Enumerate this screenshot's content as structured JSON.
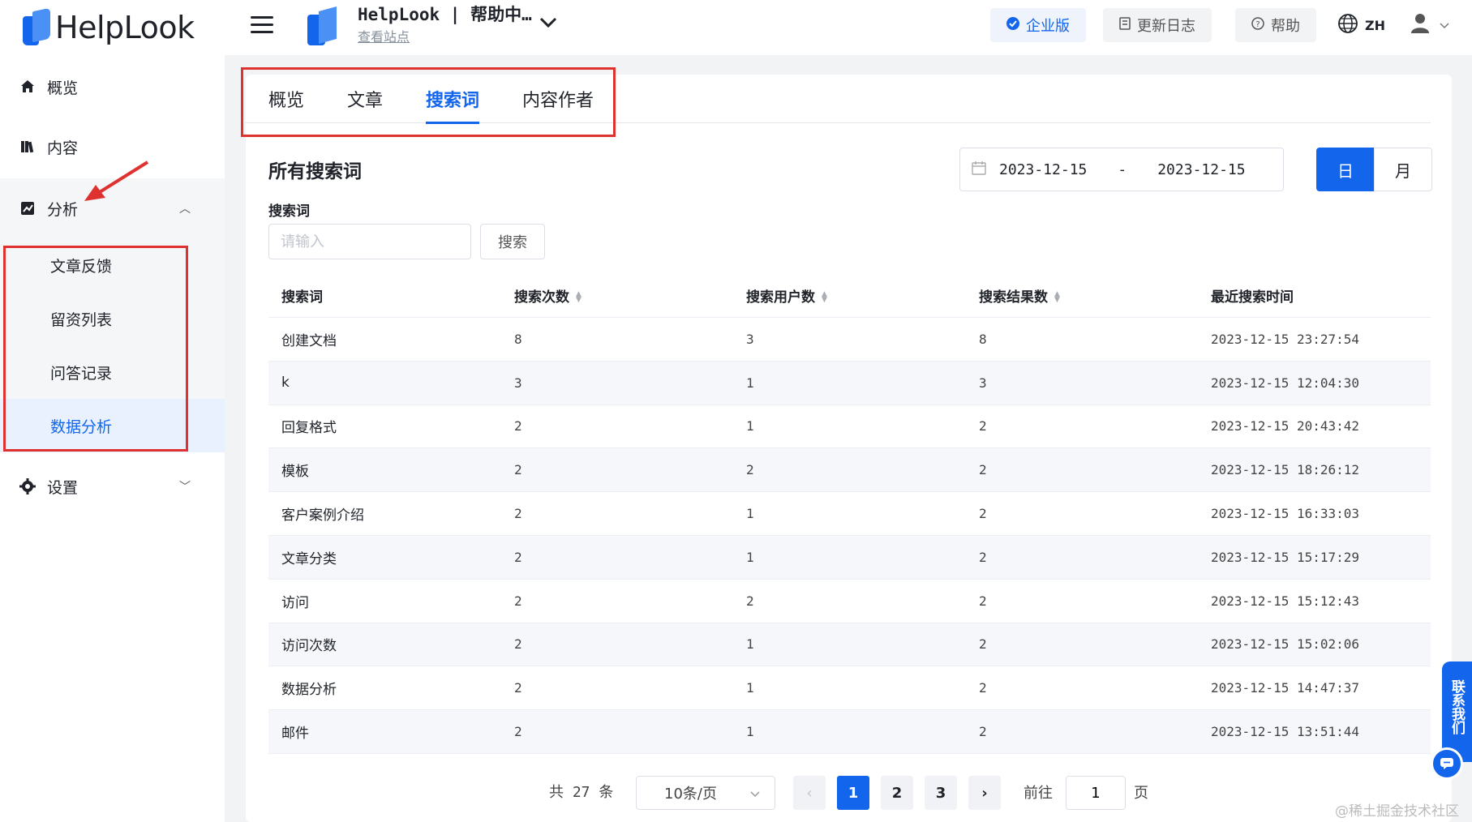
{
  "brand": {
    "name": "HelpLook"
  },
  "topbar": {
    "site_title": "HelpLook | 帮助中…",
    "site_link": "查看站点",
    "enterprise": "企业版",
    "changelog": "更新日志",
    "help": "帮助",
    "lang": "ZH"
  },
  "sidebar": {
    "overview": "概览",
    "content": "内容",
    "analytics": "分析",
    "sub": [
      "文章反馈",
      "留资列表",
      "问答记录",
      "数据分析"
    ],
    "settings": "设置"
  },
  "tabs": [
    "概览",
    "文章",
    "搜索词",
    "内容作者"
  ],
  "active_tab": "搜索词",
  "main": {
    "title": "所有搜索词",
    "date_start": "2023-12-15",
    "date_sep": "-",
    "date_end": "2023-12-15",
    "day": "日",
    "month": "月",
    "field_label": "搜索词",
    "placeholder": "请输入",
    "search_btn": "搜索"
  },
  "table": {
    "headers": [
      "搜索词",
      "搜索次数",
      "搜索用户数",
      "搜索结果数",
      "最近搜索时间"
    ],
    "rows": [
      [
        "创建文档",
        "8",
        "3",
        "8",
        "2023-12-15 23:27:54"
      ],
      [
        "k",
        "3",
        "1",
        "3",
        "2023-12-15 12:04:30"
      ],
      [
        "回复格式",
        "2",
        "1",
        "2",
        "2023-12-15 20:43:42"
      ],
      [
        "模板",
        "2",
        "2",
        "2",
        "2023-12-15 18:26:12"
      ],
      [
        "客户案例介绍",
        "2",
        "1",
        "2",
        "2023-12-15 16:33:03"
      ],
      [
        "文章分类",
        "2",
        "1",
        "2",
        "2023-12-15 15:17:29"
      ],
      [
        "访问",
        "2",
        "2",
        "2",
        "2023-12-15 15:12:43"
      ],
      [
        "访问次数",
        "2",
        "1",
        "2",
        "2023-12-15 15:02:06"
      ],
      [
        "数据分析",
        "2",
        "1",
        "2",
        "2023-12-15 14:47:37"
      ],
      [
        "邮件",
        "2",
        "1",
        "2",
        "2023-12-15 13:51:44"
      ]
    ]
  },
  "pagination": {
    "total_text": "共 27 条",
    "page_size": "10条/页",
    "pages": [
      "1",
      "2",
      "3"
    ],
    "current": "1",
    "goto_label": "前往",
    "goto_value": "1",
    "goto_suffix": "页"
  },
  "contact": "联系我们",
  "watermark": "@稀土掘金技术社区",
  "colors": {
    "accent": "#1366ec",
    "annotation": "#e03131"
  }
}
